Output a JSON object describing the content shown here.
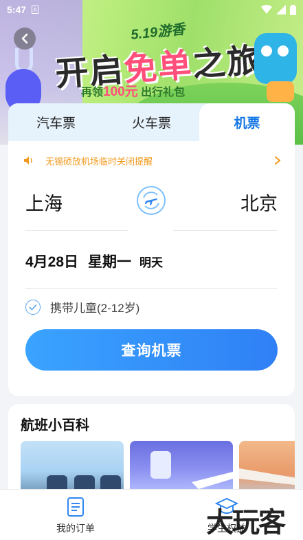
{
  "status_bar": {
    "time": "5:47",
    "notif": "A"
  },
  "banner": {
    "tag": "5.19游香",
    "title_a": "开启",
    "title_b": "免单",
    "title_c": "之旅",
    "sub_a": "再领",
    "sub_b": "100元",
    "sub_c": "出行礼包"
  },
  "tabs": [
    {
      "label": "汽车票"
    },
    {
      "label": "火车票"
    },
    {
      "label": "机票"
    }
  ],
  "notice": {
    "text": "无锡硕放机场临时关闭提醒"
  },
  "route": {
    "from": "上海",
    "to": "北京"
  },
  "date": {
    "date": "4月28日",
    "weekday": "星期一",
    "relative": "明天"
  },
  "child": {
    "label": "携带儿童(2-12岁)"
  },
  "search_button": {
    "label": "查询机票"
  },
  "wiki": {
    "title": "航班小百科"
  },
  "bottom_nav": {
    "orders": "我的订单",
    "student": "学生权益"
  },
  "watermark": "大玩客",
  "colors": {
    "accent": "#1677e6",
    "notice": "#f19a1e",
    "button_start": "#3aa3ff",
    "button_end": "#2f80f5"
  }
}
